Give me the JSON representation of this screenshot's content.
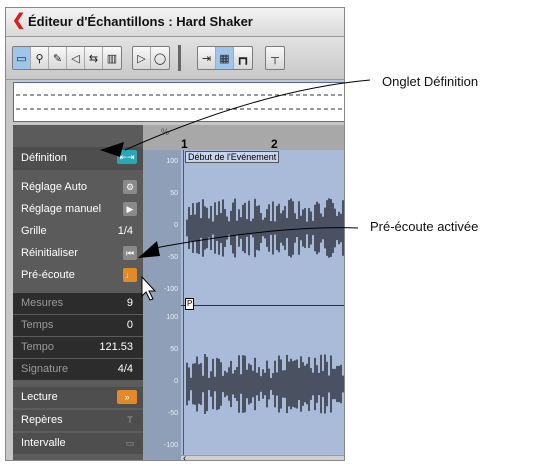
{
  "window": {
    "title": "Éditeur d'Échantillons : Hard Shaker"
  },
  "toolbar": {
    "icons": [
      "range-select-icon",
      "zoom-icon",
      "pencil-icon",
      "speaker-icon",
      "loop-icon",
      "bars-icon",
      "play-icon",
      "loop-bubble-icon",
      "snap-icon",
      "grid-icon",
      "hitpoint-icon"
    ]
  },
  "left_panel": {
    "definition_tab": "Définition",
    "items": {
      "auto": "Réglage Auto",
      "manual": "Réglage manuel",
      "grid_label": "Grille",
      "grid_value": "1/4",
      "reset": "Réinitialiser",
      "preview": "Pré-écoute"
    },
    "fields": {
      "bars_label": "Mesures",
      "bars_value": "9",
      "beats_label": "Temps",
      "beats_value": "0",
      "tempo_label": "Tempo",
      "tempo_value": "121.53",
      "sig_label": "Signature",
      "sig_value": "4/4"
    },
    "sections": {
      "playback": "Lecture",
      "markers": "Repères",
      "range": "Intervalle"
    }
  },
  "ruler": {
    "marks": [
      "1",
      "2"
    ],
    "percent": "%"
  },
  "event": {
    "start_label": "Début de l'Evénement",
    "marker": "P"
  },
  "scale": {
    "labels_top": [
      "100",
      "50",
      "0",
      "-50",
      "-100"
    ],
    "labels_bottom": [
      "100",
      "50",
      "0",
      "-50",
      "-100"
    ]
  },
  "callouts": {
    "definition_tab": "Onglet Définition",
    "preview_active": "Pré-écoute activée"
  },
  "colors": {
    "accent_teal": "#2aa6b8",
    "preview_orange": "#e08a2a",
    "wave_bg": "#a9bbd9"
  }
}
